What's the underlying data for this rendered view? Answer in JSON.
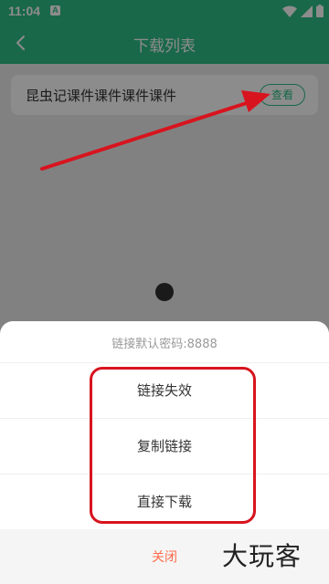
{
  "status_bar": {
    "time": "11:04",
    "sim_label": "A",
    "icons": [
      "wifi-icon",
      "signal-icon",
      "battery-icon"
    ]
  },
  "app_bar": {
    "title": "下载列表",
    "back_icon": "chevron-left-icon"
  },
  "list": {
    "items": [
      {
        "name": "昆虫记课件课件课件课件",
        "action_label": "查看"
      }
    ]
  },
  "sheet": {
    "hint": "链接默认密码:8888",
    "options": [
      "链接失效",
      "复制链接",
      "直接下载"
    ],
    "close_label": "关闭"
  },
  "watermark": "大玩客",
  "colors": {
    "brand": "#2fbd86",
    "annotation": "#d8141e",
    "close_text": "#ff6a4a"
  }
}
